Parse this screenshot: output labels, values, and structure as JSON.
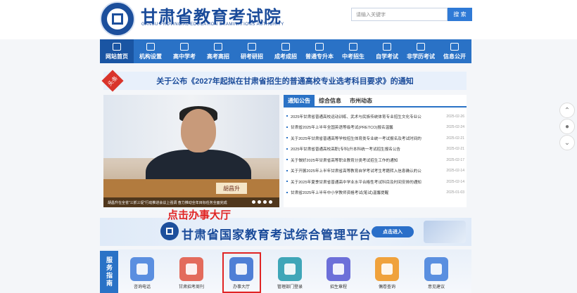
{
  "header": {
    "title": "甘肃省教育考试院",
    "subtitle": "GANSU PROVINCIAL EDUCATION EXAMINATIONS AUTHORITY",
    "search_placeholder": "请输入关键字",
    "search_label": "搜 索"
  },
  "nav": [
    {
      "label": "网站首页",
      "icon": "home-icon"
    },
    {
      "label": "机构设置",
      "icon": "building-icon"
    },
    {
      "label": "高中学考",
      "icon": "graduation-icon"
    },
    {
      "label": "高考高招",
      "icon": "graduation-cap-icon"
    },
    {
      "label": "研考研招",
      "icon": "graduation-hat-icon"
    },
    {
      "label": "成考成招",
      "icon": "pencil-icon"
    },
    {
      "label": "普通专升本",
      "icon": "book-icon"
    },
    {
      "label": "中考招生",
      "icon": "globe-icon"
    },
    {
      "label": "自学考试",
      "icon": "person-icon"
    },
    {
      "label": "非学历考试",
      "icon": "people-icon"
    },
    {
      "label": "信息公开",
      "icon": "mail-icon"
    }
  ],
  "notice": {
    "tag": "头条",
    "text": "关于公布《2027年起拟在甘肃省招生的普通高校专业选考科目要求》的通知"
  },
  "photo": {
    "nameplate": "胡昌升",
    "caption": "胡昌升在全省“三抓三促”行动推进会议上强调 奋力推动全年目标任务全面完成"
  },
  "news": {
    "tabs": [
      "通知公告",
      "综合信息",
      "市州动态"
    ],
    "items": [
      {
        "title": "2025年甘肃省普通高校运动训练、武术与民族传统体育专业招生文化专业公",
        "date": "2025-02-26"
      },
      {
        "title": "甘肃省2025年上半年全国英语等级考试(PRETCO)报名温馨",
        "date": "2025-02-24"
      },
      {
        "title": "关于2025年甘肃省普通高等学校招生体育类专业统一考试报名及考试时间的",
        "date": "2025-02-21"
      },
      {
        "title": "2025年甘肃省普通高校高职(专科)升本科统一考试招生报名公告",
        "date": "2025-02-21"
      },
      {
        "title": "关于做好2025年甘肃省高等职业教育分类考试招生工作的通知",
        "date": "2025-02-17"
      },
      {
        "title": "关于开展2025年上半年甘肃省高等教育自学考试考生考籍转入信息确认的公",
        "date": "2025-02-14"
      },
      {
        "title": "关于2025年夏季甘肃省普通高中学业水平合格性考试科目及时间安排的通知",
        "date": "2025-02-14"
      },
      {
        "title": "甘肃省2025年上半年中小学教师资格考试(笔试)温馨提醒",
        "date": "2025-01-03"
      }
    ]
  },
  "banner": {
    "title": "甘肃省国家教育考试综合管理平台",
    "button": "点击进入"
  },
  "annotation": "点击办事大厅",
  "service": {
    "tag": "服务指南",
    "items": [
      {
        "label": "咨询电话",
        "color": "#5b8fe0",
        "icon": "phone-icon"
      },
      {
        "label": "甘肃招考周刊",
        "color": "#e36b5c",
        "icon": "magazine-icon"
      },
      {
        "label": "办事大厅",
        "color": "#4f7fd6",
        "icon": "office-icon"
      },
      {
        "label": "管理部门登录",
        "color": "#3fa6b8",
        "icon": "login-icon"
      },
      {
        "label": "招生章程",
        "color": "#6c6fd9",
        "icon": "document-icon"
      },
      {
        "label": "偶卷查询",
        "color": "#f0a23c",
        "icon": "search-doc-icon"
      },
      {
        "label": "意见建议",
        "color": "#5a8fe0",
        "icon": "feedback-icon"
      }
    ]
  }
}
